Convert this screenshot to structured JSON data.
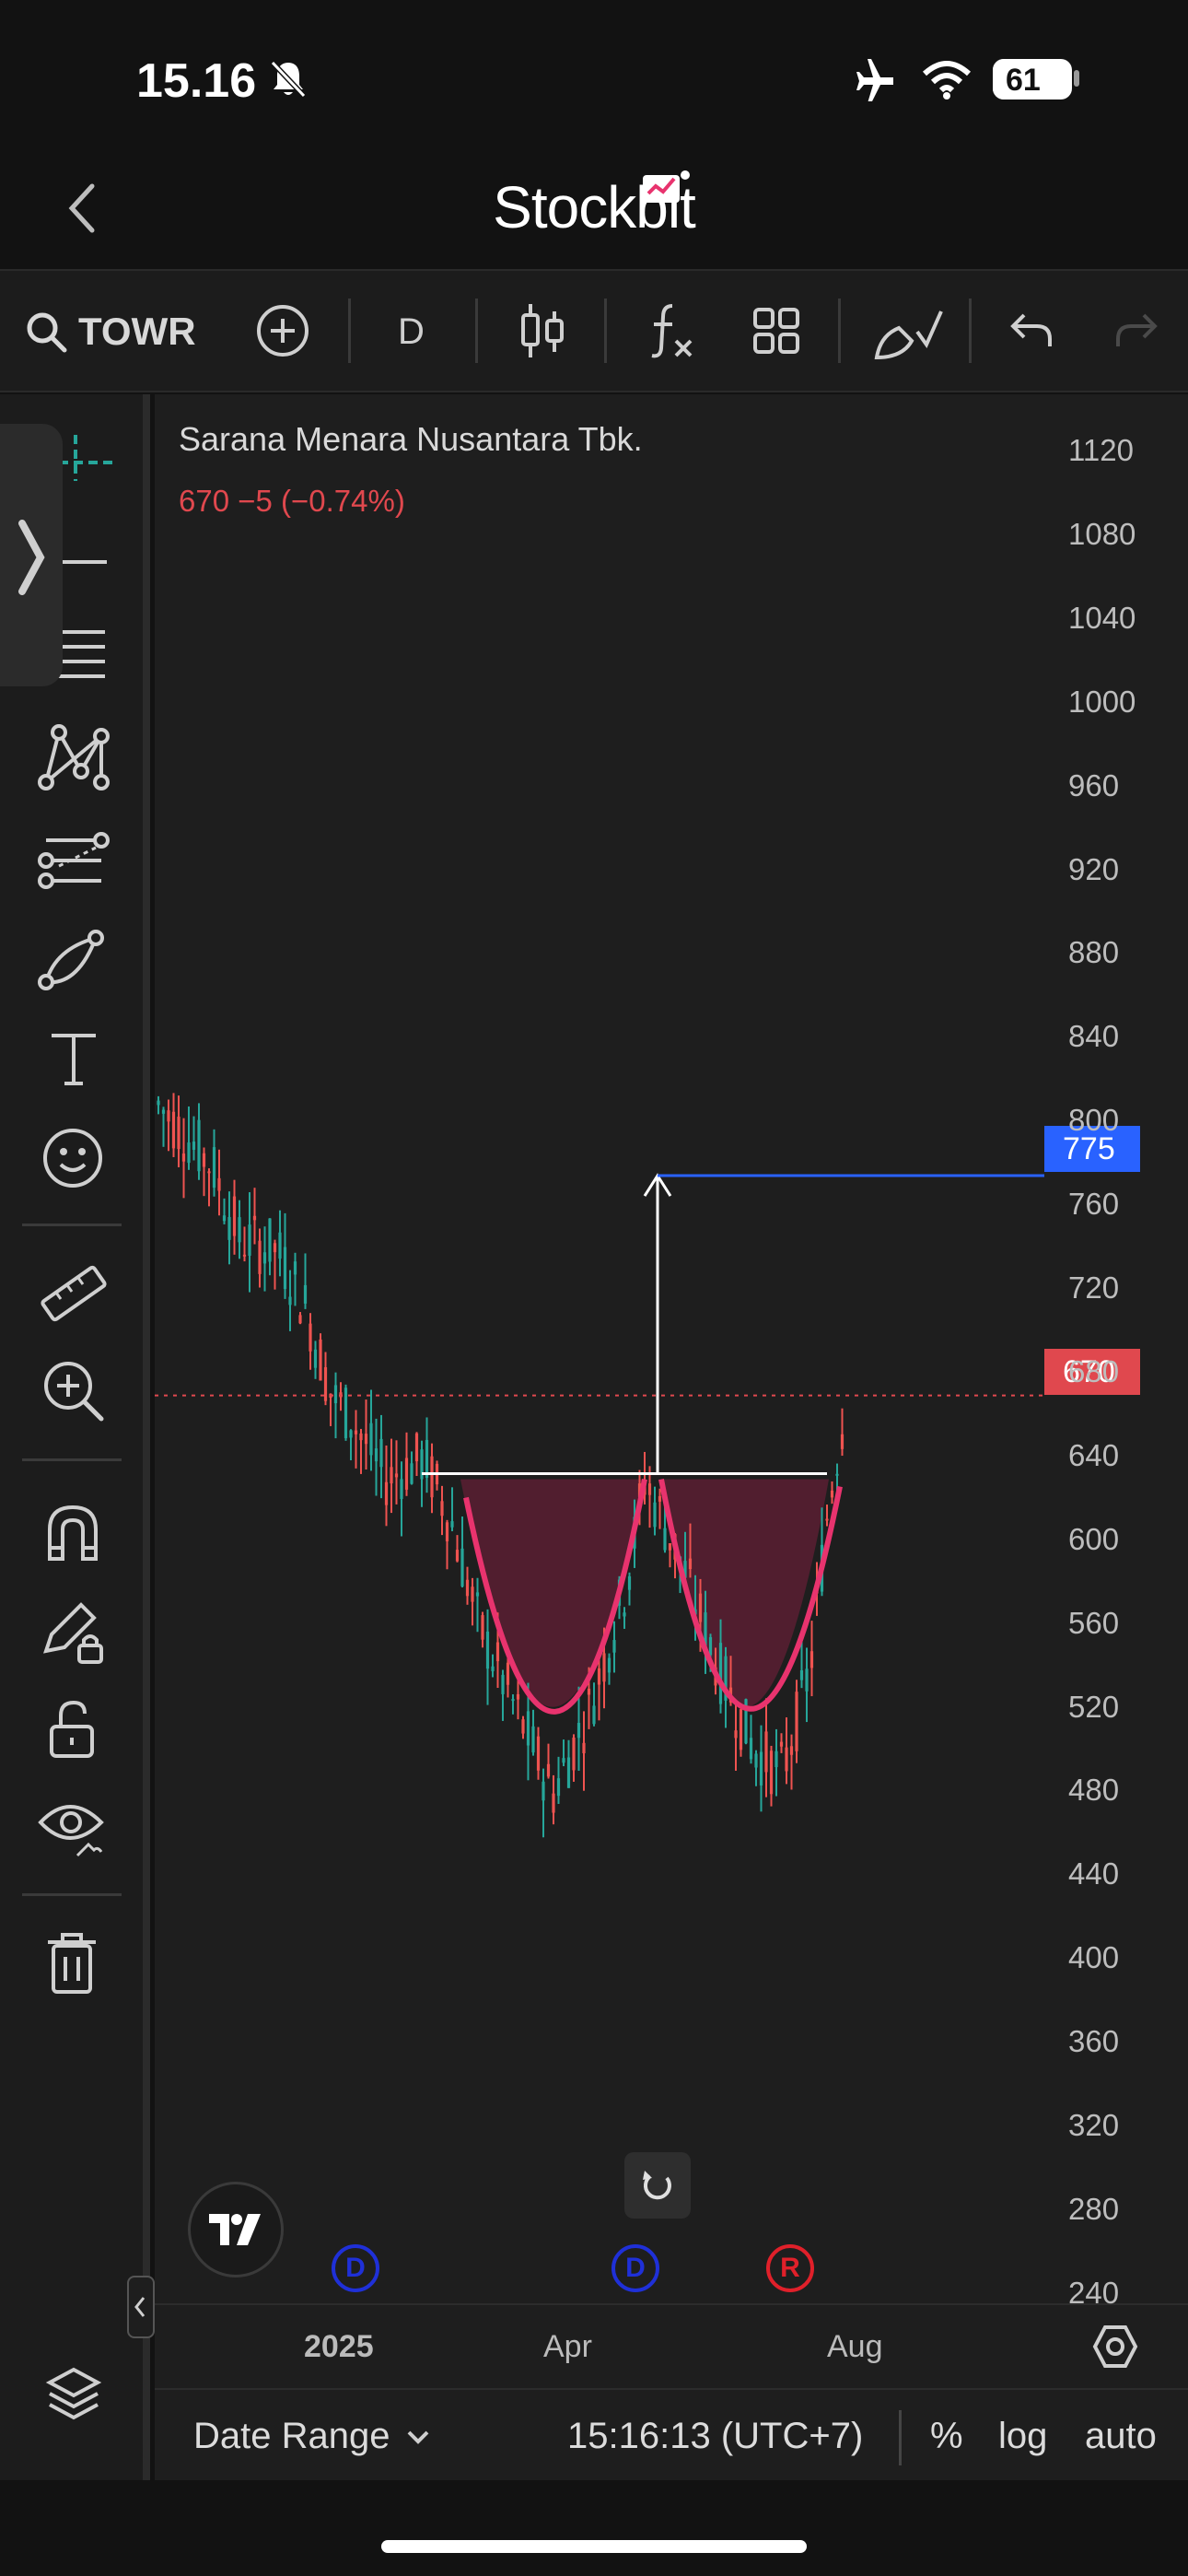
{
  "status_bar": {
    "time": "15.16",
    "battery": "61"
  },
  "header": {
    "brand": "Stockbit"
  },
  "toolbar": {
    "symbol": "TOWR",
    "interval": "D"
  },
  "chart": {
    "name": "Sarana Menara Nusantara Tbk.",
    "price_change": "670  −5 (−0.74%)",
    "price_ticks": [
      "1120",
      "1080",
      "1040",
      "1000",
      "960",
      "920",
      "880",
      "840",
      "800",
      "760",
      "720",
      "680",
      "640",
      "600",
      "560",
      "520",
      "480",
      "440",
      "400",
      "360",
      "320",
      "280",
      "240"
    ],
    "target_badge": "775",
    "last_badge": "670",
    "x_labels": [
      "2025",
      "Apr",
      "Aug"
    ],
    "events": [
      "D",
      "D",
      "R"
    ],
    "colors": {
      "up": "#26a69a",
      "down": "#ef5350",
      "pattern": "#e8336e",
      "target": "#2962ff",
      "last": "#e0484e"
    }
  },
  "chart_data": {
    "type": "candlestick",
    "title": "Sarana Menara Nusantara Tbk.",
    "symbol": "TOWR",
    "interval": "D",
    "ylim": [
      240,
      1120
    ],
    "last_price": 670,
    "change": -5,
    "change_pct": -0.74,
    "target_line": 775,
    "neckline": 630,
    "x_ticks": [
      "2025",
      "Apr",
      "Aug"
    ]
  },
  "bottom_bar": {
    "date_range": "Date Range",
    "clock": "15:16:13 (UTC+7)",
    "percent": "%",
    "log": "log",
    "auto": "auto"
  }
}
